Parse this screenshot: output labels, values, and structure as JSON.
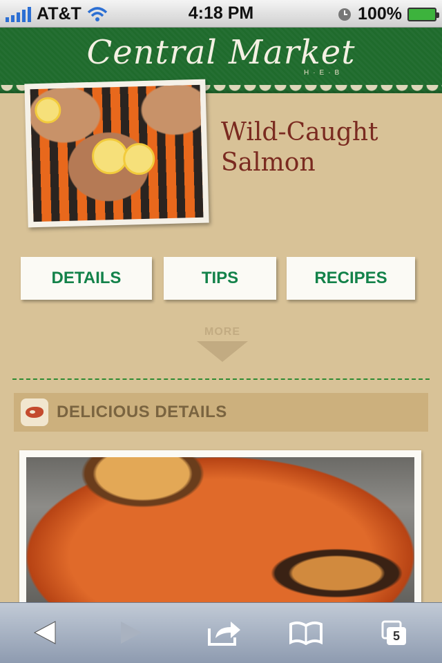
{
  "status_bar": {
    "carrier": "AT&T",
    "time": "4:18 PM",
    "battery": "100%"
  },
  "header": {
    "brand": "Central Market",
    "brand_sub": "H·E·B"
  },
  "hero": {
    "title": "Wild-Caught Salmon"
  },
  "tabs": [
    {
      "label": "DETAILS"
    },
    {
      "label": "TIPS"
    },
    {
      "label": "RECIPES"
    }
  ],
  "more": {
    "label": "MORE"
  },
  "section": {
    "title": "DELICIOUS DETAILS"
  },
  "toolbar": {
    "back_icon": "back-arrow-icon",
    "forward_icon": "forward-arrow-icon",
    "share_icon": "share-icon",
    "bookmarks_icon": "bookmarks-icon",
    "tabs_icon": "tabs-icon",
    "tabs_count": "5"
  },
  "colors": {
    "page_bg": "#d8c297",
    "header_green": "#236a31",
    "title_red": "#7a2a20",
    "tab_text_green": "#13824a",
    "section_bar": "#ccb07d"
  }
}
